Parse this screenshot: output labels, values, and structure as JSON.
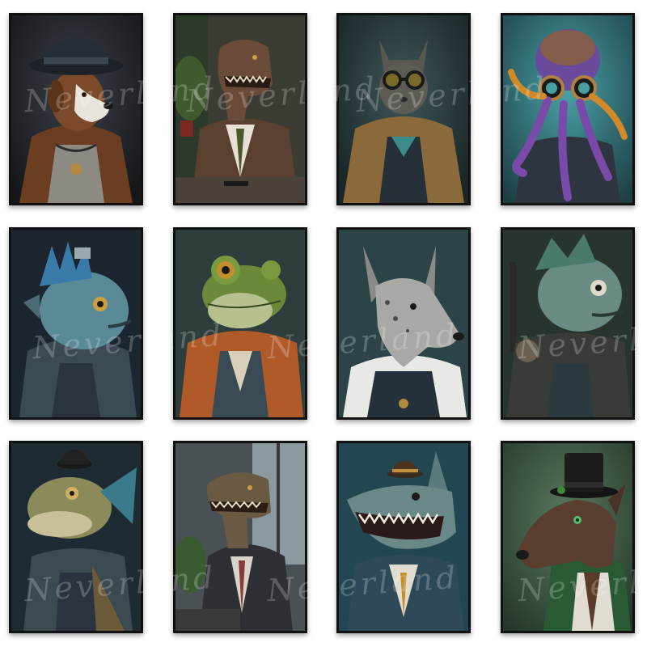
{
  "watermark_text": "Neverland",
  "posters": [
    {
      "subject": "dog-in-hat",
      "bg": "#2a2d33"
    },
    {
      "subject": "t-rex-in-suit",
      "bg": "#3a3a32"
    },
    {
      "subject": "cat-with-goggles",
      "bg": "#2b3a3c"
    },
    {
      "subject": "octopus-with-helmet",
      "bg": "#2e6b70"
    },
    {
      "subject": "fish-with-crown",
      "bg": "#1e2a33"
    },
    {
      "subject": "frog-in-jacket",
      "bg": "#2f3f3e"
    },
    {
      "subject": "dog-in-suit",
      "bg": "#2c4448"
    },
    {
      "subject": "fish-in-armor",
      "bg": "#2a3a36"
    },
    {
      "subject": "fish-in-bowler",
      "bg": "#1f2b33"
    },
    {
      "subject": "t-rex-by-window",
      "bg": "#4d5458"
    },
    {
      "subject": "shark-in-hat",
      "bg": "#264a55"
    },
    {
      "subject": "greyhound-in-top-hat",
      "bg": "#3a5a44"
    }
  ]
}
